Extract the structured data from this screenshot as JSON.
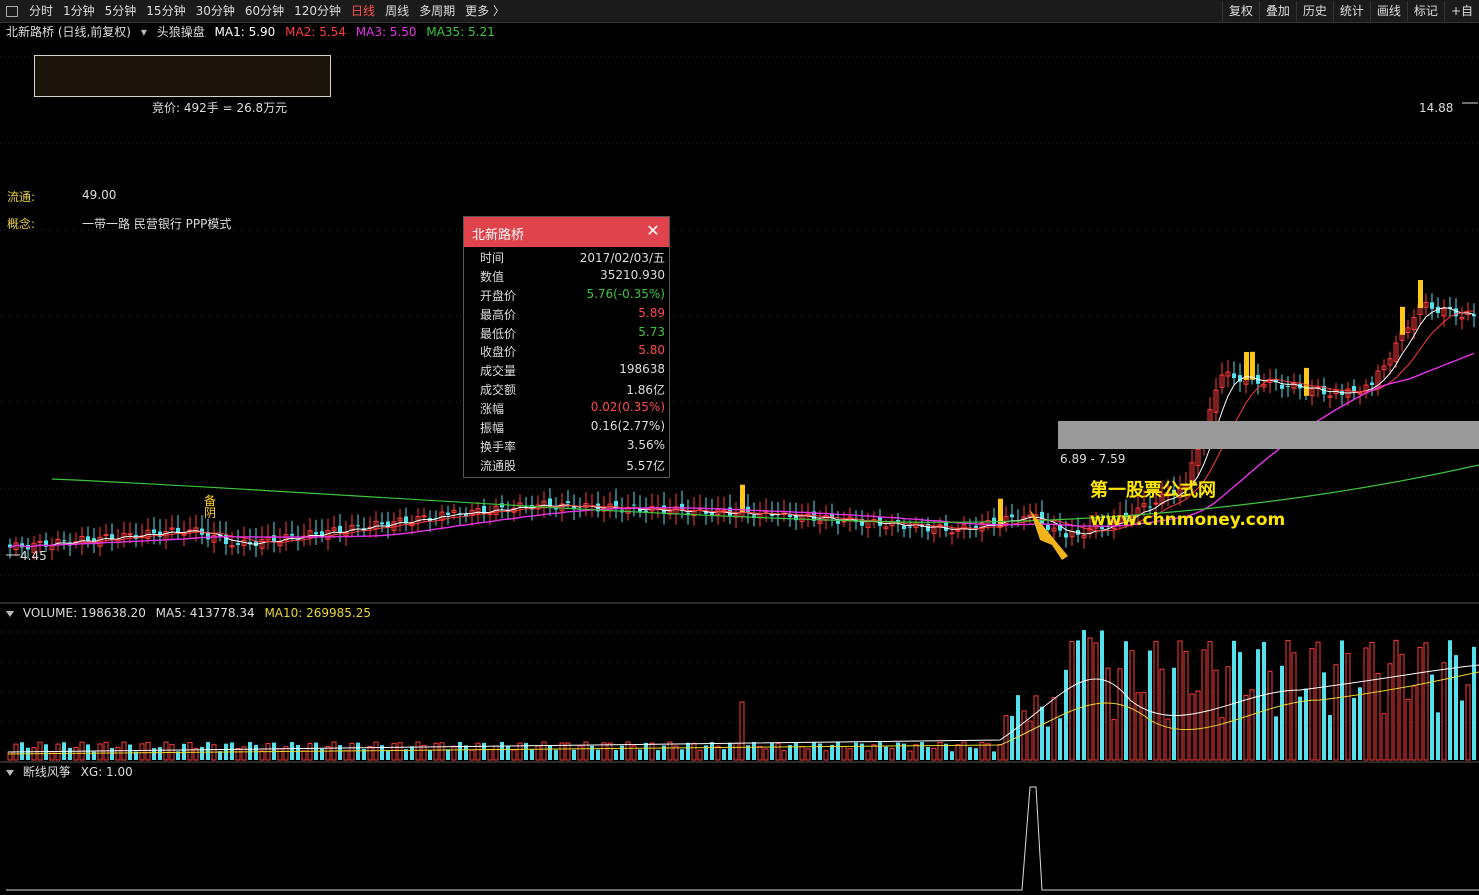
{
  "toolbar": {
    "periods": [
      "分时",
      "1分钟",
      "5分钟",
      "15分钟",
      "30分钟",
      "60分钟",
      "120分钟",
      "日线",
      "周线",
      "多周期",
      "更多 〉"
    ],
    "active_period": "日线",
    "right_buttons": [
      "复权",
      "叠加",
      "历史",
      "统计",
      "画线",
      "标记",
      "+自"
    ]
  },
  "header": {
    "stock_title": "北新路桥 (日线,前复权)",
    "indicator_name": "头狼操盘",
    "ma1": "MA1: 5.90",
    "ma2": "MA2: 5.54",
    "ma3": "MA3: 5.50",
    "ma35": "MA35: 5.21",
    "colors": {
      "ma1": "#ffffff",
      "ma2": "#ff3b3b",
      "ma3": "#e633e6",
      "ma35": "#3ec53e"
    }
  },
  "auction": {
    "text": "竞价: 492手 = 26.8万元"
  },
  "info": {
    "float_label": "流通:",
    "float_value": "49.00",
    "concept_label": "概念:",
    "concept_value": "一带一路 民营银行 PPP模式"
  },
  "popup": {
    "title": "北新路桥",
    "rows": [
      {
        "k": "时间",
        "v": "2017/02/03/五",
        "c": ""
      },
      {
        "k": "数值",
        "v": "35210.930",
        "c": ""
      },
      {
        "k": "开盘价",
        "v": "5.76(-0.35%)",
        "c": "dn"
      },
      {
        "k": "最高价",
        "v": "5.89",
        "c": "up"
      },
      {
        "k": "最低价",
        "v": "5.73",
        "c": "dn"
      },
      {
        "k": "收盘价",
        "v": "5.80",
        "c": "up"
      },
      {
        "k": "成交量",
        "v": "198638",
        "c": ""
      },
      {
        "k": "成交额",
        "v": "1.86亿",
        "c": ""
      },
      {
        "k": "涨幅",
        "v": "0.02(0.35%)",
        "c": "up"
      },
      {
        "k": "振幅",
        "v": "0.16(2.77%)",
        "c": ""
      },
      {
        "k": "换手率",
        "v": "3.56%",
        "c": ""
      },
      {
        "k": "流通股",
        "v": "5.57亿",
        "c": ""
      }
    ]
  },
  "chart": {
    "high_label": "14.88",
    "low_label": "4.45",
    "zone_label": "6.89 - 7.59",
    "marker_text": "备\n阴",
    "watermark_cn": "第一股票公式网",
    "watermark_url": "www.chnmoney.com"
  },
  "volume_panel": {
    "title": "VOLUME: 198638.20",
    "ma5": "MA5: 413778.34",
    "ma10": "MA10: 269985.25"
  },
  "xg_panel": {
    "title": "断线风筝",
    "xg": "XG: 1.00"
  }
}
